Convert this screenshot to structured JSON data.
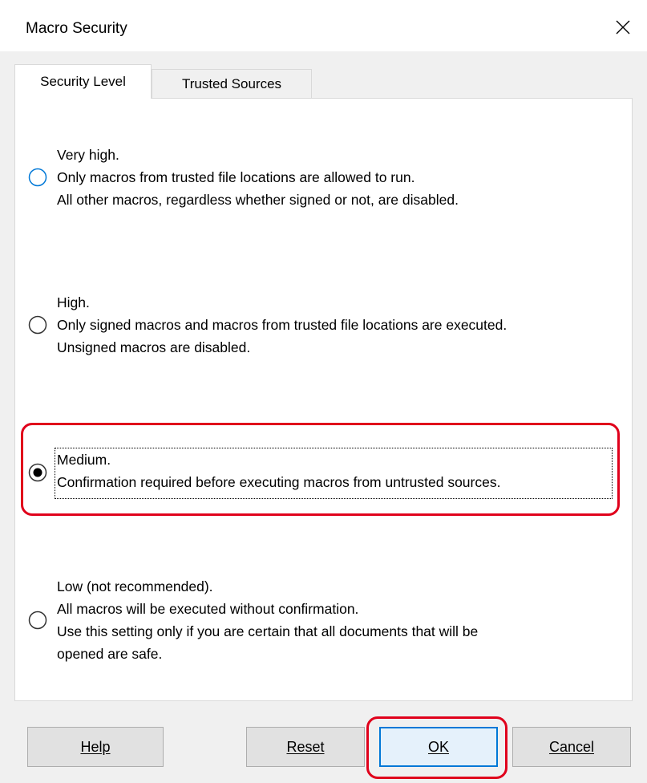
{
  "window": {
    "title": "Macro Security",
    "close_icon": "close-icon"
  },
  "tabs": [
    {
      "label": "Security Level",
      "active": true
    },
    {
      "label": "Trusted Sources",
      "active": false
    }
  ],
  "options": [
    {
      "selected": false,
      "lines": [
        "Very high.",
        "Only macros from trusted file locations are allowed to run.",
        "All other macros, regardless whether signed or not, are disabled."
      ]
    },
    {
      "selected": false,
      "lines": [
        "High.",
        "Only signed macros and macros from trusted file locations are executed.",
        "Unsigned macros are disabled."
      ]
    },
    {
      "selected": true,
      "lines": [
        "Medium.",
        "Confirmation required before executing macros from untrusted sources."
      ]
    },
    {
      "selected": false,
      "lines": [
        "Low (not recommended).",
        "All macros will be executed without confirmation.",
        "Use this setting only if you are certain that all documents that will be",
        "opened are safe."
      ]
    }
  ],
  "buttons": {
    "help": "Help",
    "reset": "Reset",
    "ok": "OK",
    "cancel": "Cancel"
  },
  "colors": {
    "highlight": "#e0001b",
    "accent": "#0078d7"
  }
}
